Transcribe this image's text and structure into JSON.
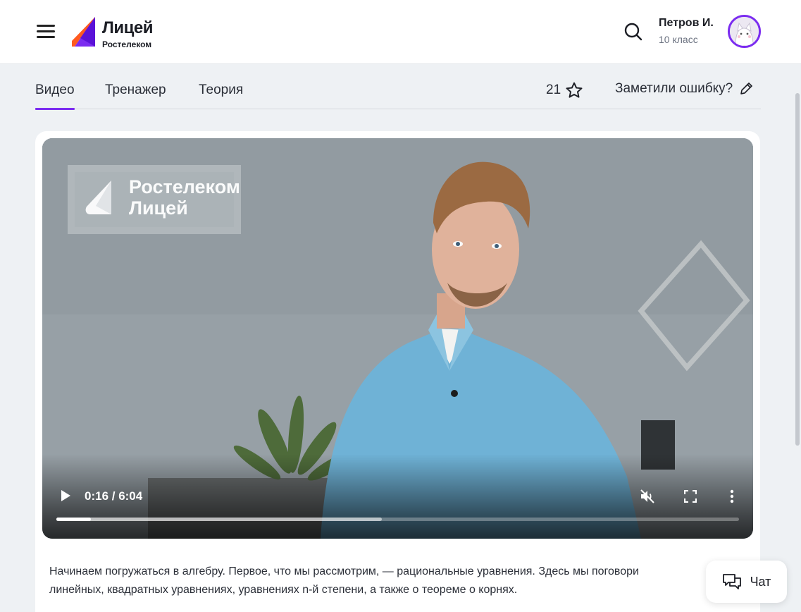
{
  "header": {
    "logo_title": "Лицей",
    "logo_subtitle": "Ростелеком",
    "user_name": "Петров И.",
    "user_class": "10 класс"
  },
  "tabs": [
    {
      "label": "Видео",
      "active": true
    },
    {
      "label": "Тренажер",
      "active": false
    },
    {
      "label": "Теория",
      "active": false
    }
  ],
  "rating": {
    "count": "21"
  },
  "report_error": "Заметили ошибку?",
  "video": {
    "watermark_line1": "Ростелеком",
    "watermark_line2": "Лицей",
    "time": "0:16 / 6:04",
    "played_fraction": 0.051,
    "buffered_fraction": 0.477
  },
  "description": {
    "line1": "Начинаем погружаться в алгебру. Первое, что мы рассмотрим, — рациональные уравнения. Здесь мы поговори",
    "line2": "линейных, квадратных уравнениях, уравнениях n-й степени, а также о теореме о корнях."
  },
  "chat": {
    "label": "Чат"
  },
  "colors": {
    "accent": "#7b2cf0",
    "logo_orange": "#ff5a1f"
  }
}
